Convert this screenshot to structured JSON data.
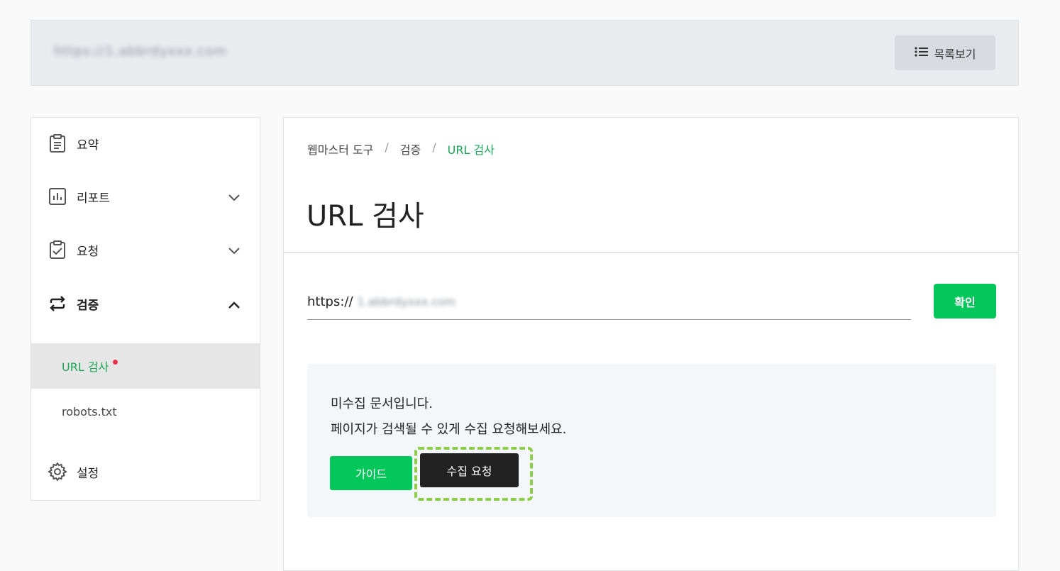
{
  "header": {
    "site_url": "https://1.abbrdyxxx.com",
    "list_button_label": "목록보기"
  },
  "sidebar": {
    "items": [
      {
        "label": "요약",
        "icon": "clipboard-list-icon"
      },
      {
        "label": "리포트",
        "icon": "bar-chart-icon",
        "expanded": false
      },
      {
        "label": "요청",
        "icon": "clipboard-check-icon",
        "expanded": false
      },
      {
        "label": "검증",
        "icon": "repeat-arrows-icon",
        "expanded": true
      },
      {
        "label": "설정",
        "icon": "gear-icon"
      }
    ],
    "sub_items": [
      {
        "label": "URL 검사",
        "active": true,
        "has_dot": true
      },
      {
        "label": "robots.txt",
        "active": false
      }
    ]
  },
  "main": {
    "breadcrumb": [
      "웹마스터 도구",
      "검증",
      "URL 검사"
    ],
    "breadcrumb_sep": "/",
    "title": "URL 검사",
    "url_input": {
      "prefix": "https://",
      "value": "1.abbrdyxxx.com"
    },
    "confirm_label": "확인",
    "notice": {
      "line1": "미수집 문서입니다.",
      "line2": "페이지가 검색될 수 있게 수집 요청해보세요.",
      "guide_label": "가이드",
      "request_label": "수집 요청"
    }
  },
  "colors": {
    "accent_green": "#03c75a",
    "active_text_green": "#1aa556",
    "highlight_dash": "#8dcc4a",
    "notification_dot": "#e8334a"
  }
}
